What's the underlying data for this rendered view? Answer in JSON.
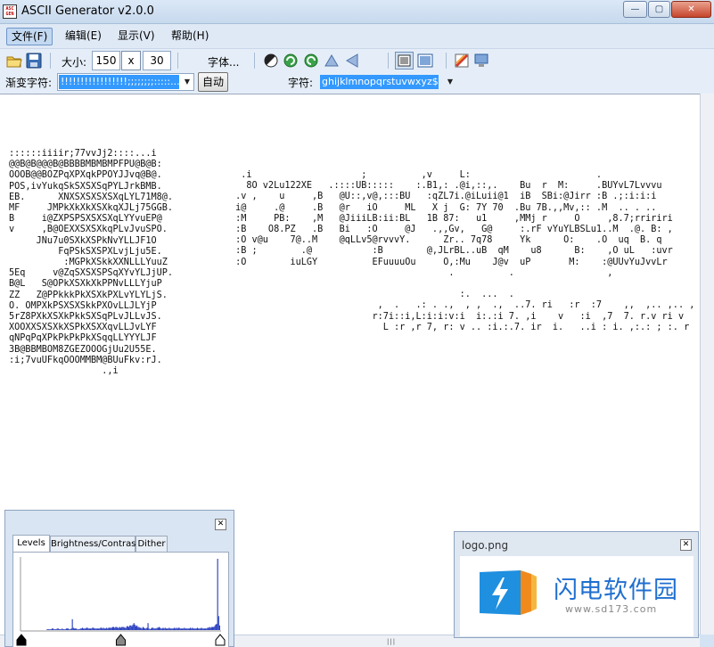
{
  "window": {
    "title": "ASCII Generator v2.0.0",
    "icon_text": "ASC\nGEN",
    "min": "—",
    "max": "▢",
    "close": "✕"
  },
  "menu": [
    "文件(F)",
    "编辑(E)",
    "显示(V)",
    "帮助(H)"
  ],
  "toolbar": {
    "size_label": "大小:",
    "width": "150",
    "x_label": "x",
    "height": "30",
    "font_button": "字体..."
  },
  "toolbar2": {
    "ramp_label": "渐变字符:",
    "ramp_value": "!!!!!!!!!!!!!!!!!;;;;;;;;:::::...........",
    "auto_button": "自动",
    "chars_label": "字符:",
    "chars_value": "ghijklmnopqrstuvwxyz$"
  },
  "ascii": {
    "left": "::::::iiiir;77vvJj2::::...i\n@@B@B@@@B@BBBBMBMBMPFPU@B@B:\nOOOB@@BOZPqXPXqkPPOYJJvq@B@.\nPOS,ivYukqSkSXSXSqPYLJrkBMB.\nEB.      XNXSXSXSXSXqLYL71M8@.\nMF     JMPkXkXkXSXkqXJLj75GGB.\nB     i@ZXPSPSXSXSXqLYYvuEP@\nv     ,B@OEXXSXSXkqPLvJvuSPO.\n     JNu7u0SXkXSPkNvYLLJF1O\n         FqPSkSXSPXLvjLju5E.\n          :MGPkXSkkXXNLLLYuuZ\n5Eq     v@ZqSXSXSPSqXYvYLJjUP.\nB@L   S@OPkXSXkXkPPNvLLLYjuP\nZZ   Z@PPkkkPkXSXkPXLvYLYLjS.\nO. OMPXkPSXSXSkkPXOvLLJLYjP\n5rZ8PXkXSXkPkkSXSqPLvJLLvJS.\nXOOXXSXSXkXSPkXSXXqvLLJvLYF\nqNPqPqXPkPkPkPkXSqqLLYYYLJF\n3B@BBMBOM8ZGEZOOOGjUu2U55E.\n:i;7vuUFkqOOOMMBM@BUuFkv:rJ.\n                 .,i",
    "right": "  .i                    ;          ,v     L:                       .\n   8O v2Lu122XE   .::::UB:::::    :.B1,: .@i,::,.    Bu  r  M:     .BUYvL7Lvvvu\n .v ,    u     ,B   @U::,v@,:::BU   :qZL7i.@iLuii@1  iB  SBi:@Jirr :B .;:i:i:i\n i@     .@     .B   @r   iO     ML   X j  G: 7Y 70  .Bu 7B.,,Mv,:: .M  .. . ..\n :M     PB:    ,M   @JiiiLB:ii:BL   1B 87:   u1     ,MMj r     O     ,8.7;rririri\n :B    O8.PZ   .B   Bi   :O     @J   .,,Gv,   G@     :.rF vYuYLBSLu1..M  .@. B: ,\n :O v@u    7@..M    @qLLv5@rvvvY.      Zr.. 7q78     Yk      O:    .O  uq  B. q\n :B ;        .@           :B        @,JLrBL..uB  qM    u8      B:    ,O uL   :uvr\n :O        iuLGY          EFuuuuOu     O,:Mu    J@v  uP       M:    :@UUvYuJvvLr\n                                        .          .                 ,\n\n                                          :.  ...  .\n                           ,  .   .: . .,  , ,  .,  ..7. ri   :r  :7    ,,  ,.. ,.. ,\n                          r:7i::i,L:i:i:v:i  i:.:i 7. ,i    v   :i  ,7  7. r.v ri v\n                            L :r ,r 7, r: v .. :i.:.7. ir  i.   ..i : i. ,:.: ; :. r"
  },
  "levels_panel": {
    "close": "✕",
    "tabs": [
      "Levels",
      "Brightness/Contrast",
      "Dither"
    ],
    "histogram": [
      0,
      0,
      0,
      0,
      0,
      0,
      0,
      0,
      0,
      0,
      0,
      0,
      0,
      0,
      0,
      0,
      0,
      0,
      0,
      0,
      0,
      0,
      0,
      0,
      0,
      1,
      1,
      1,
      1,
      1,
      2,
      2,
      1,
      1,
      1,
      2,
      2,
      1,
      1,
      1,
      2,
      1,
      1,
      1,
      2,
      2,
      2,
      1,
      1,
      2,
      14,
      3,
      2,
      2,
      2,
      1,
      1,
      1,
      2,
      2,
      3,
      2,
      2,
      2,
      3,
      3,
      2,
      2,
      2,
      2,
      3,
      3,
      2,
      2,
      2,
      2,
      2,
      2,
      3,
      3,
      2,
      3,
      2,
      2,
      3,
      2,
      3,
      3,
      3,
      3,
      4,
      4,
      3,
      4,
      4,
      3,
      3,
      4,
      3,
      4,
      4,
      4,
      3,
      3,
      5,
      5,
      4,
      6,
      6,
      5,
      7,
      9,
      7,
      5,
      6,
      4,
      4,
      3,
      3,
      2,
      4,
      3,
      2,
      2,
      3,
      9,
      2,
      1,
      2,
      3,
      3,
      2,
      2,
      2,
      3,
      3,
      4,
      3,
      2,
      2,
      3,
      2,
      3,
      2,
      2,
      2,
      3,
      2,
      2,
      2,
      2,
      3,
      2,
      3,
      2,
      3,
      3,
      2,
      2,
      2,
      2,
      3,
      2,
      2,
      2,
      2,
      2,
      3,
      2,
      3,
      2,
      2,
      2,
      2,
      3,
      2,
      2,
      2,
      3,
      2,
      2,
      2,
      2,
      2,
      3,
      3,
      4,
      3,
      4,
      4,
      4,
      5,
      7,
      8,
      92,
      18,
      6
    ],
    "black_point": 0,
    "gamma_point": 0.5,
    "white_point": 1.0
  },
  "logo_window": {
    "title": "logo.png",
    "close": "✕",
    "brand_cn": "闪电软件园",
    "url": "www.sd173.com"
  },
  "colors": {
    "accent": "#3399ff",
    "logo_blue": "#1f6fd0",
    "logo_orange": "#f08a1d"
  }
}
